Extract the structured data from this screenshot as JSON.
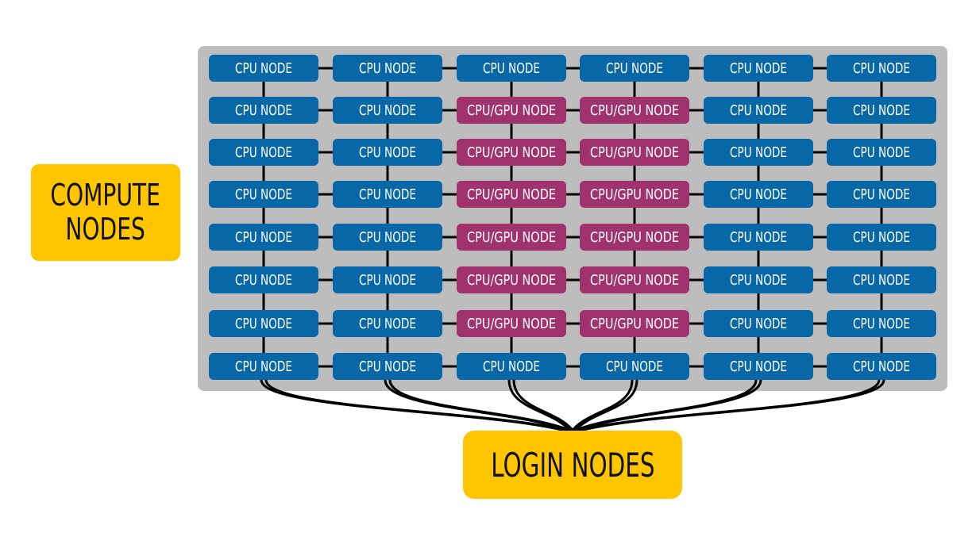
{
  "compute_label": {
    "line1": "COMPUTE",
    "line2": "NODES"
  },
  "login_label": "LOGIN NODES",
  "colors": {
    "cpu_node": "#0867a6",
    "gpu_node": "#a0336e",
    "panel": "#bdbdbd",
    "label": "#ffc600",
    "link": "#000000"
  },
  "node_labels": {
    "cpu": "CPU NODE",
    "gpu": "CPU/GPU NODE"
  },
  "grid": [
    [
      "cpu",
      "cpu",
      "cpu",
      "cpu",
      "cpu",
      "cpu"
    ],
    [
      "cpu",
      "cpu",
      "gpu",
      "gpu",
      "cpu",
      "cpu"
    ],
    [
      "cpu",
      "cpu",
      "gpu",
      "gpu",
      "cpu",
      "cpu"
    ],
    [
      "cpu",
      "cpu",
      "gpu",
      "gpu",
      "cpu",
      "cpu"
    ],
    [
      "cpu",
      "cpu",
      "gpu",
      "gpu",
      "cpu",
      "cpu"
    ],
    [
      "cpu",
      "cpu",
      "gpu",
      "gpu",
      "cpu",
      "cpu"
    ],
    [
      "cpu",
      "cpu",
      "gpu",
      "gpu",
      "cpu",
      "cpu"
    ],
    [
      "cpu",
      "cpu",
      "cpu",
      "cpu",
      "cpu",
      "cpu"
    ]
  ]
}
